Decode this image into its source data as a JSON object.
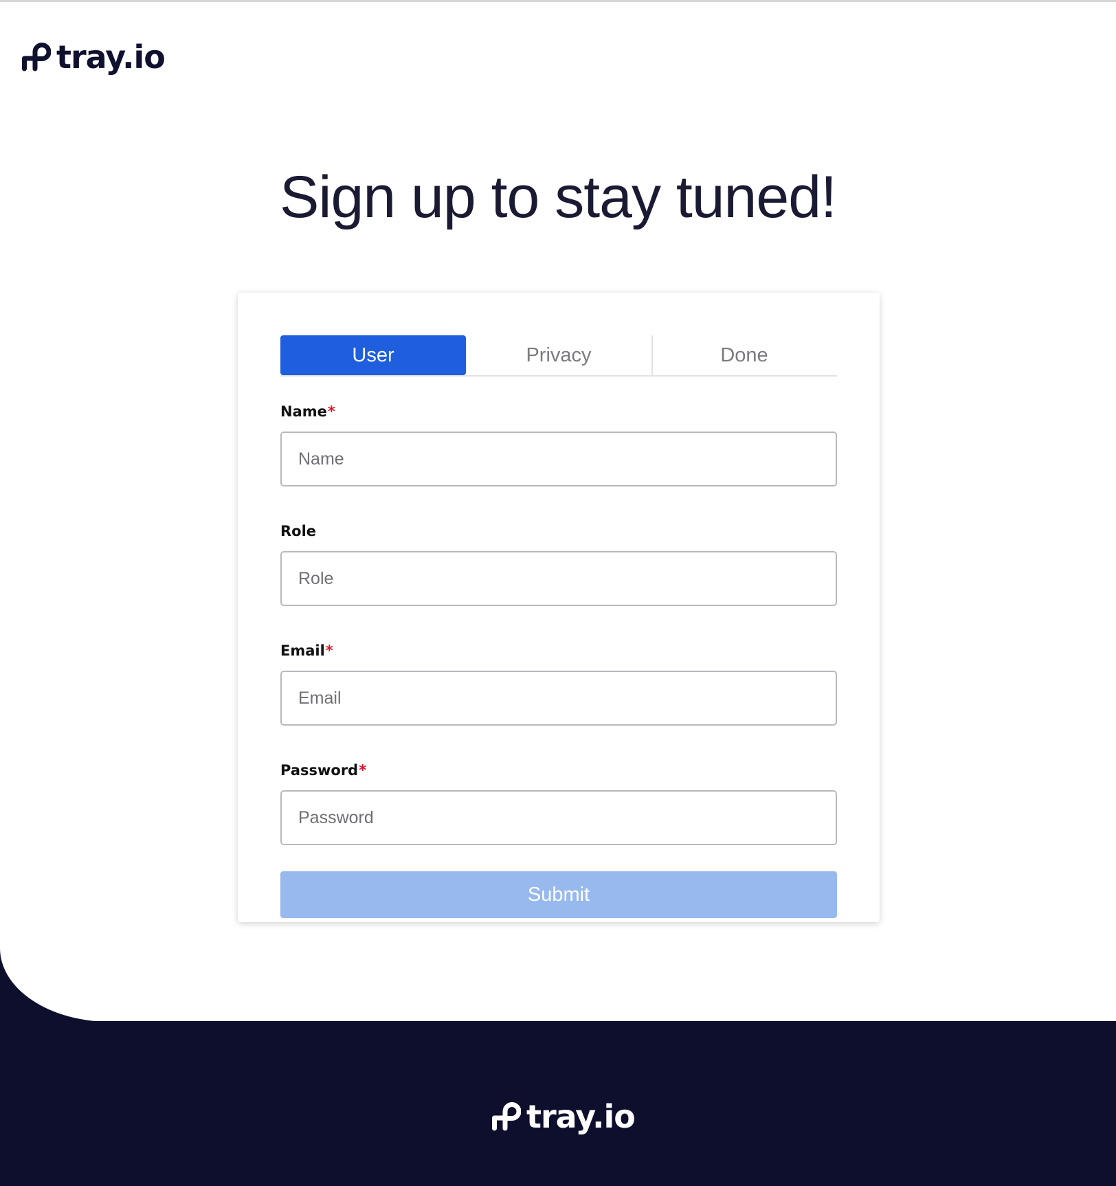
{
  "brand": {
    "logo_text": "tray.io",
    "colors": {
      "navy": "#0e0f2d",
      "primary_blue": "#1f5ede",
      "disabled_blue": "#97b9ee",
      "required_red": "#e0142b"
    }
  },
  "header": {
    "logo_icon": "tray-logo-icon",
    "logo_text": "tray.io"
  },
  "page": {
    "title": "Sign up to stay tuned!"
  },
  "signup_card": {
    "tabs": [
      {
        "label": "User",
        "active": true
      },
      {
        "label": "Privacy",
        "active": false
      },
      {
        "label": "Done",
        "active": false
      }
    ],
    "fields": {
      "name": {
        "label": "Name",
        "required_mark": "*",
        "placeholder": "Name",
        "value": ""
      },
      "role": {
        "label": "Role",
        "placeholder": "Role",
        "value": ""
      },
      "email": {
        "label": "Email",
        "required_mark": "*",
        "placeholder": "Email",
        "value": ""
      },
      "password": {
        "label": "Password",
        "required_mark": "*",
        "placeholder": "Password",
        "value": ""
      }
    },
    "submit_label": "Submit",
    "submit_disabled": true
  },
  "footer": {
    "logo_icon": "tray-logo-icon",
    "logo_text": "tray.io"
  }
}
